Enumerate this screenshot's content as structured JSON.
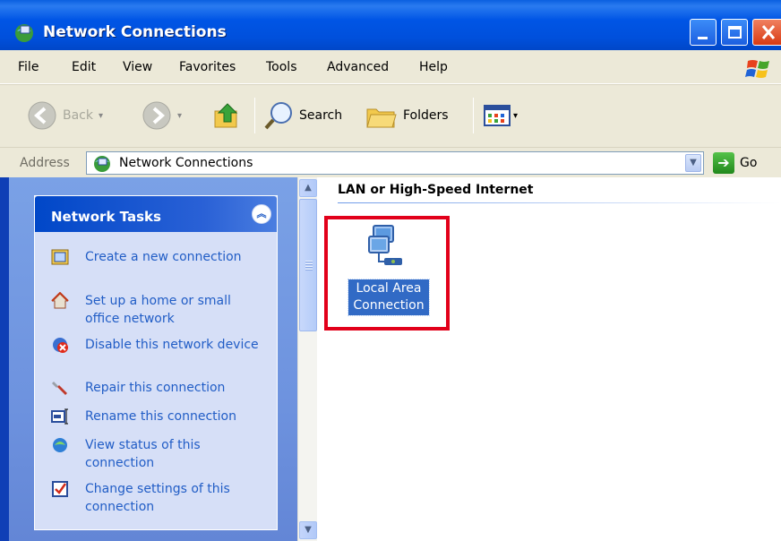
{
  "window": {
    "title": "Network Connections"
  },
  "menu": [
    "File",
    "Edit",
    "View",
    "Favorites",
    "Tools",
    "Advanced",
    "Help"
  ],
  "toolbar": {
    "back_label": "Back",
    "search_label": "Search",
    "folders_label": "Folders"
  },
  "address": {
    "label": "Address",
    "value": "Network Connections",
    "go_label": "Go"
  },
  "task_pane": {
    "title": "Network Tasks",
    "tasks": [
      {
        "label": "Create a new connection",
        "icon": "new-connection-icon"
      },
      {
        "label": "Set up a home or small office network",
        "icon": "home-network-icon"
      },
      {
        "label": "Disable this network device",
        "icon": "disable-device-icon"
      },
      {
        "label": "Repair this connection",
        "icon": "repair-icon"
      },
      {
        "label": "Rename this connection",
        "icon": "rename-icon"
      },
      {
        "label": "View status of this connection",
        "icon": "status-icon"
      },
      {
        "label": "Change settings of this connection",
        "icon": "settings-icon"
      }
    ]
  },
  "main": {
    "group_header": "LAN or High-Speed Internet",
    "item": {
      "label_line1": "Local Area",
      "label_line2": "Connection",
      "selected": true
    }
  },
  "colors": {
    "xp_blue": "#0055e5",
    "selection": "#316ac5",
    "highlight_border": "#e2001a",
    "task_link": "#215dc6"
  }
}
